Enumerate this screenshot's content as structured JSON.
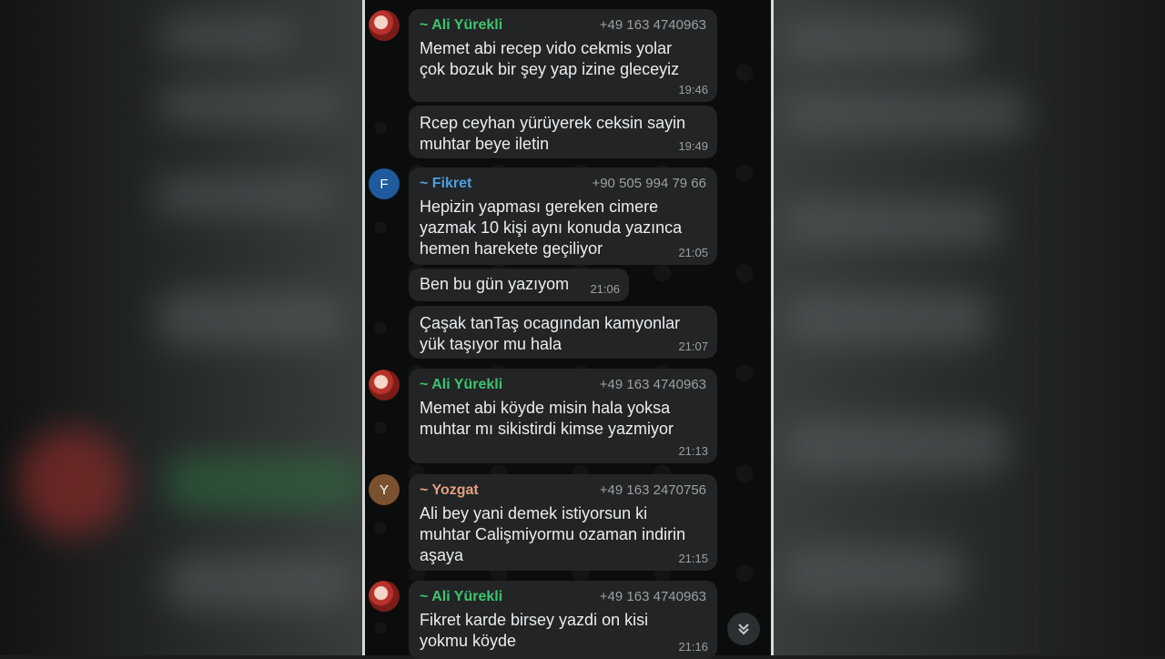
{
  "messages": [
    {
      "sender": "~ Ali Yürekli",
      "phone": "+49 163 4740963",
      "text": "Memet abi recep vido cekmis yolar\nçok bozuk bir şey yap izine gleceyiz",
      "time": "19:46"
    },
    {
      "text": "Rcep ceyhan yürüyerek ceksin  sayin\nmuhtar beye iletin",
      "time": "19:49"
    },
    {
      "sender": "~ Fikret",
      "phone": "+90 505 994 79 66",
      "text": "Hepizin yapması gereken cimere\nyazmak 10 kişi aynı konuda yazınca\nhemen harekete geçiliyor",
      "time": "21:05"
    },
    {
      "text": "Ben bu gün yazıyom",
      "time": "21:06"
    },
    {
      "text": "Çaşak tanTaş ocagından kamyonlar\nyük taşıyor mu hala",
      "time": "21:07"
    },
    {
      "sender": "~ Ali Yürekli",
      "phone": "+49 163 4740963",
      "text": "Memet abi köyde misin hala yoksa\nmuhtar mı sikistirdi kimse yazmiyor",
      "time": "21:13"
    },
    {
      "sender": "~ Yozgat",
      "phone": "+49 163 2470756",
      "text": "Ali  bey yani demek istiyorsun ki\nmuhtar Calişmiyormu  ozaman indirin\naşaya",
      "time": "21:15"
    },
    {
      "sender": "~ Ali Yürekli",
      "phone": "+49 163 4740963",
      "text": "Fikret karde birsey yazdi  on kisi\nyokmu köyde",
      "time": "21:16"
    }
  ],
  "avatars": {
    "fikret": "F",
    "yozgat": "Y"
  },
  "colors": {
    "ali": "#3ec46d",
    "fikret": "#4f9fe0",
    "yozgat": "#e0a080"
  },
  "icons": {
    "scroll_down": "double-chevron-down-icon"
  }
}
